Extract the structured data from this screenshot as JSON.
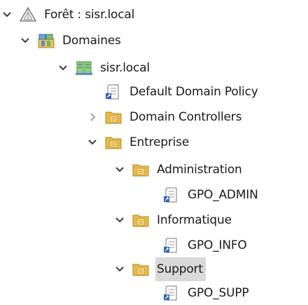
{
  "tree": {
    "forest": {
      "label": "Forêt : sisr.local",
      "expanded": true,
      "icon": "forest-icon"
    },
    "domains": {
      "label": "Domaines",
      "expanded": true,
      "icon": "domains-icon"
    },
    "domain": {
      "label": "sisr.local",
      "expanded": true,
      "icon": "domain-icon"
    },
    "default_policy": {
      "label": "Default Domain Policy",
      "icon": "gpo-link-icon"
    },
    "domain_controllers": {
      "label": "Domain Controllers",
      "expanded": false,
      "icon": "ou-folder-icon"
    },
    "entreprise": {
      "label": "Entreprise",
      "expanded": true,
      "icon": "ou-folder-icon"
    },
    "administration": {
      "label": "Administration",
      "expanded": true,
      "icon": "ou-folder-icon"
    },
    "gpo_admin": {
      "label": "GPO_ADMIN",
      "icon": "gpo-link-icon"
    },
    "informatique": {
      "label": "Informatique",
      "expanded": true,
      "icon": "ou-folder-icon"
    },
    "gpo_info": {
      "label": "GPO_INFO",
      "icon": "gpo-link-icon"
    },
    "support": {
      "label": "Support",
      "expanded": true,
      "selected": true,
      "icon": "ou-folder-icon"
    },
    "gpo_supp": {
      "label": "GPO_SUPP",
      "icon": "gpo-link-icon"
    }
  },
  "colors": {
    "selection": "#d9d9d9",
    "chevron": "#3c3c3c",
    "chevron_collapsed": "#a6a6a6",
    "folder": "#e8b84a"
  }
}
